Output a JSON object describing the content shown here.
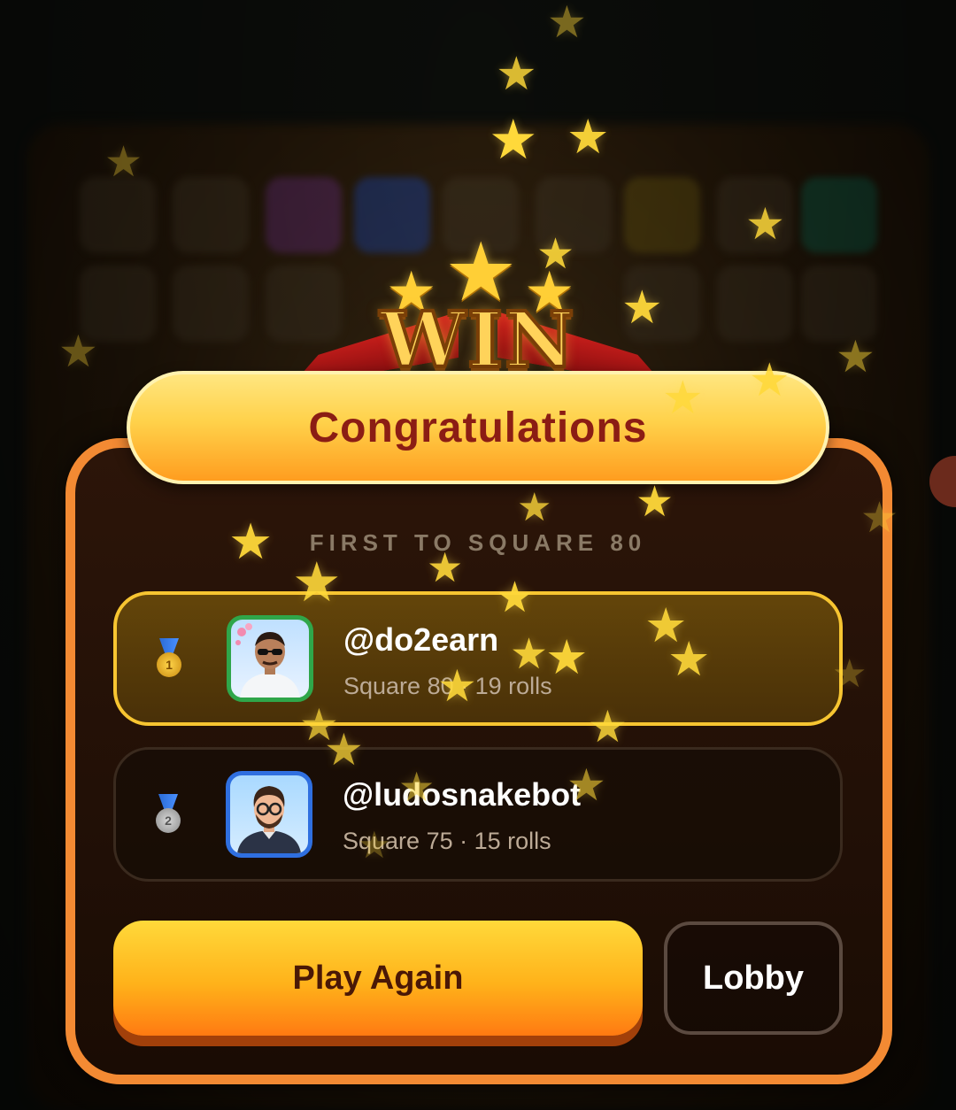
{
  "banner": {
    "win_text": "WIN",
    "congrats": "Congratulations"
  },
  "game": {
    "mode": "FIRST TO SQUARE 80"
  },
  "players": [
    {
      "rank": "1",
      "name": "@do2earn",
      "stats": "Square 80 · 19 rolls",
      "medal": "gold-medal-icon",
      "avatar_color": "#2fa64a"
    },
    {
      "rank": "2",
      "name": "@ludosnakebot",
      "stats": "Square 75 · 15 rolls",
      "medal": "silver-medal-icon",
      "avatar_color": "#2f6fe0"
    }
  ],
  "actions": {
    "play_again": "Play Again",
    "lobby": "Lobby"
  },
  "colors": {
    "accent_orange": "#f38a33",
    "gold": "#f7c531",
    "congrats_text": "#8b1d14",
    "star": "#ffd93a"
  }
}
